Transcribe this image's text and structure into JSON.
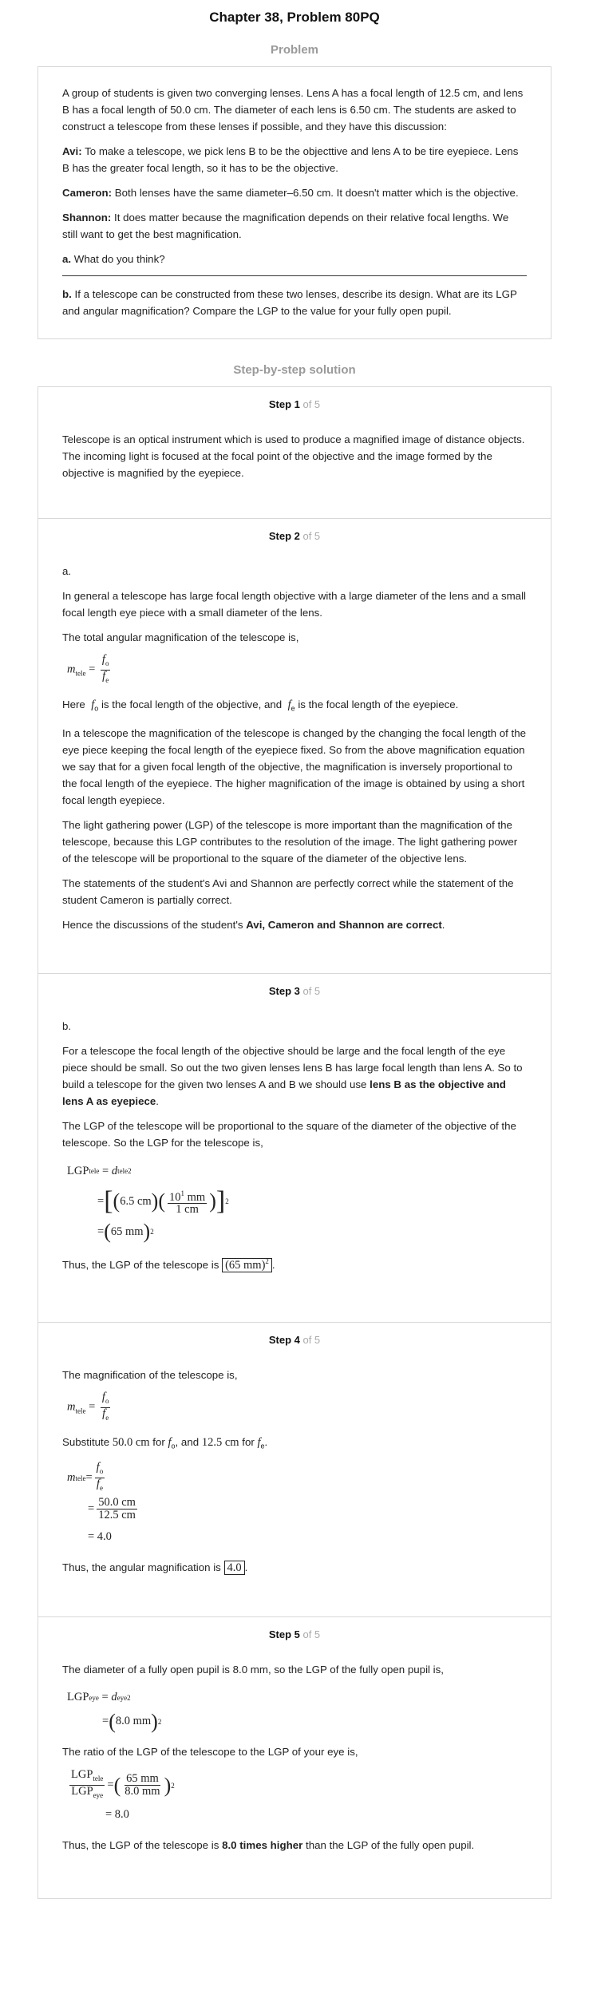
{
  "title": "Chapter 38, Problem 80PQ",
  "problem_heading": "Problem",
  "problem": {
    "intro": "A group of students is given two converging lenses. Lens A has a focal length of 12.5 cm, and lens B has a focal length of 50.0 cm. The diameter of each lens is 6.50 cm. The students are asked to construct a telescope from these lenses if possible, and they have this discussion:",
    "avi_name": "Avi:",
    "avi_text": " To make a telescope, we pick lens B to be the objecttive and lens A to be tire eyepiece. Lens B has the greater focal length, so it has to be the objective.",
    "cameron_name": "Cameron:",
    "cameron_text": " Both lenses have the same diameter–6.50 cm. It doesn't matter which is the objective.",
    "shannon_name": "Shannon:",
    "shannon_text": " It does matter because the magnification depends on their relative focal lengths. We still want to get the best magnification.",
    "a_label": "a.",
    "a_text": " What do you think?",
    "b_label": "b.",
    "b_text": " If a telescope can be constructed from these two lenses, describe its design. What are its LGP and angular magnification? Compare the LGP to the value for your fully open pupil."
  },
  "solution_heading": "Step-by-step solution",
  "steps": {
    "s1": {
      "label": "Step 1",
      "of": " of 5",
      "p1": "Telescope is an optical instrument which is used to produce a magnified image of distance objects. The incoming light is focused at the focal point of the objective and the image formed by the objective is magnified by the eyepiece."
    },
    "s2": {
      "label": "Step 2",
      "of": " of 5",
      "part": "a.",
      "p1": "In general a telescope has large focal length objective with a large diameter of the lens and a small focal length eye piece with a small diameter of the lens.",
      "p2": "The total angular magnification of the telescope is,",
      "here": "Here",
      "here_mid": "is the focal length of the objective, and",
      "here_end": "is the focal length of the eyepiece.",
      "p3": "In a telescope the magnification of the telescope is changed by the changing the focal length of the eye piece keeping the focal length of the eyepiece fixed. So from the above magnification equation we say that for a given focal length of the objective, the magnification is inversely proportional to the focal length of the eyepiece. The higher magnification of the image is obtained by using a short focal length eyepiece.",
      "p4": "The light gathering power (LGP) of the telescope is more important than the magnification of the telescope, because this LGP contributes to the resolution of the image. The light gathering power of the telescope will be proportional to the square of the diameter of the objective lens.",
      "p5": "The statements of the student's Avi and Shannon are perfectly correct while the statement of the student Cameron is partially correct.",
      "p6a": "Hence the discussions of the student's ",
      "p6b": "Avi, Cameron and Shannon are correct",
      "p6c": "."
    },
    "s3": {
      "label": "Step 3",
      "of": " of 5",
      "part": "b.",
      "p1a": "For a telescope the focal length of the objective should be large and the focal length of the eye piece should be small. So out the two given lenses lens B has large focal length than lens A. So to build a telescope for the given two lenses A and B we should use ",
      "p1b": "lens B as the objective and lens A as eyepiece",
      "p1c": ".",
      "p2": "The LGP of the telescope will be proportional to the square of the diameter of the objective of the telescope. So the LGP for the telescope is,",
      "p3": "Thus, the LGP of the telescope is"
    },
    "s4": {
      "label": "Step 4",
      "of": " of 5",
      "p1": "The magnification of the telescope is,",
      "sub": "Substitute",
      "sub_v1": "50.0 cm",
      "sub_for": "for",
      "sub_and": ", and",
      "sub_v2": "12.5 cm",
      "p2": "Thus, the angular magnification is",
      "result": "4.0"
    },
    "s5": {
      "label": "Step 5",
      "of": " of 5",
      "p1": "The diameter of a fully open pupil is 8.0 mm, so the LGP of the fully open pupil is,",
      "p2": "The ratio of the LGP of the telescope to the LGP of your eye is,",
      "p3a": "Thus, the LGP of the telescope is ",
      "p3b": "8.0 times higher",
      "p3c": " than the LGP of the fully open pupil."
    }
  }
}
